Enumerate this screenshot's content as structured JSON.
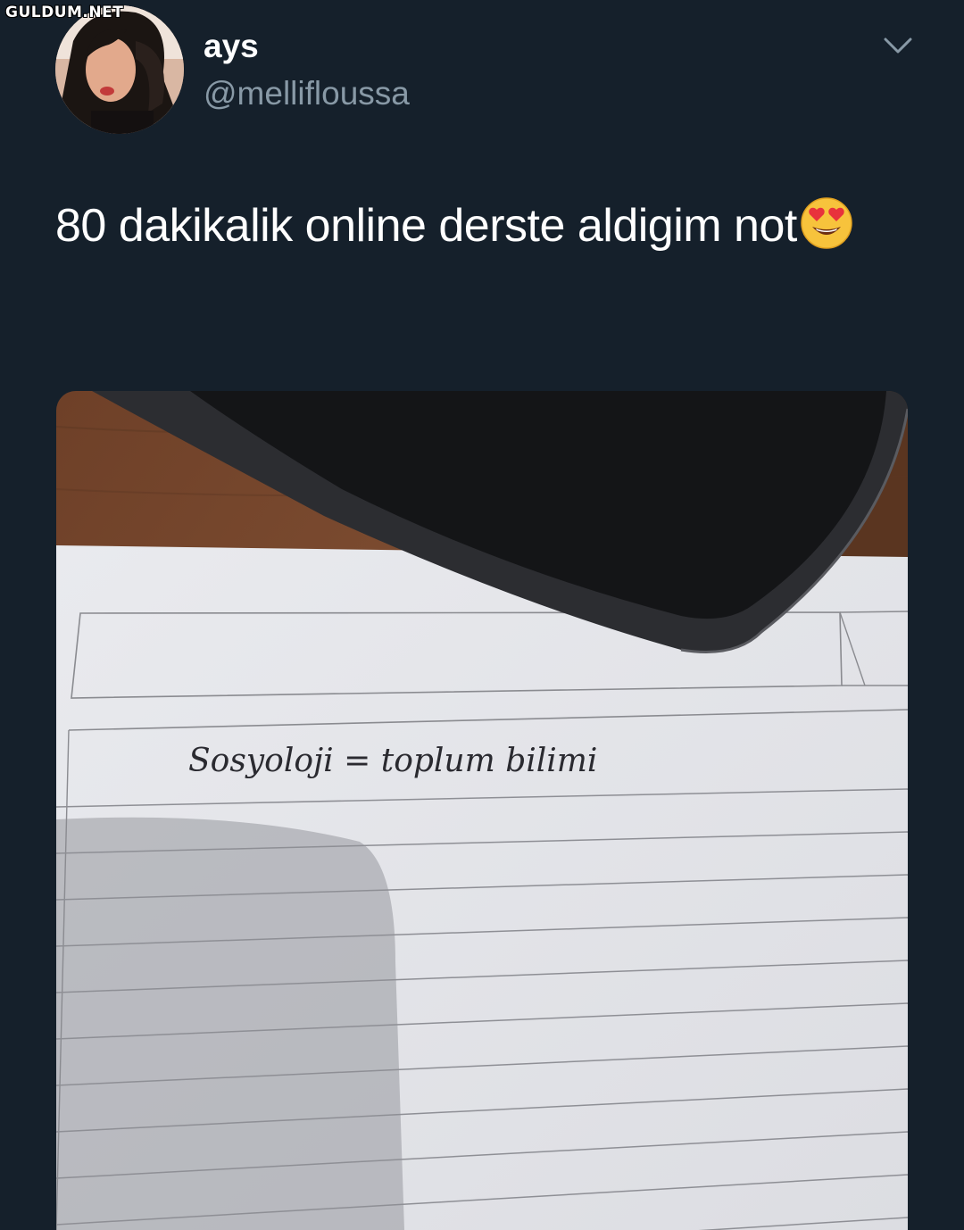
{
  "watermark": "GULDUM.NET",
  "tweet": {
    "author_name": "ays",
    "author_handle": "@mellifloussa",
    "text": "80 dakikalik online derste aldigim not",
    "emoji_icon": "smiling-face-with-heart-eyes",
    "handwritten_note": "Sosyoloji = toplum bilimi"
  },
  "colors": {
    "background": "#15202b",
    "text_primary": "#ffffff",
    "text_secondary": "#8899a6"
  }
}
